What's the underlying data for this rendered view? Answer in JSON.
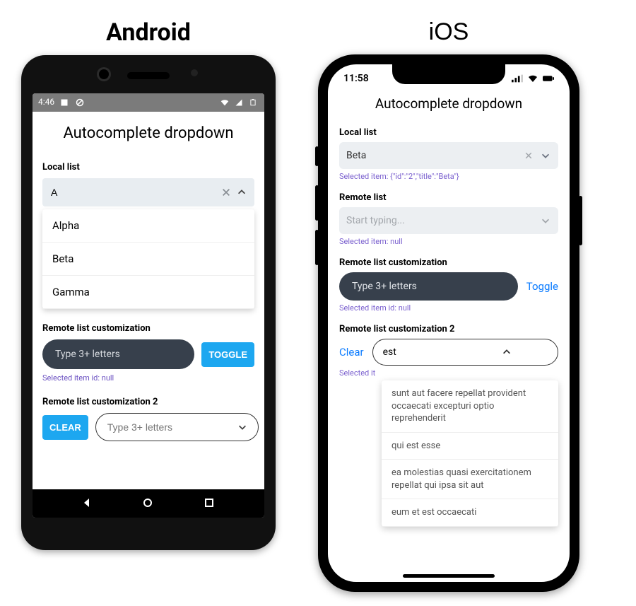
{
  "platforms": {
    "android": "Android",
    "ios": "iOS"
  },
  "android": {
    "status": {
      "time": "4:46"
    },
    "title": "Autocomplete dropdown",
    "local": {
      "heading": "Local list",
      "value": "A",
      "options": [
        "Alpha",
        "Beta",
        "Gamma"
      ]
    },
    "remote_custom": {
      "heading": "Remote list customization",
      "placeholder": "Type 3+ letters",
      "toggle": "TOGGLE",
      "hint": "Selected item id: null"
    },
    "remote_custom2": {
      "heading": "Remote list customization 2",
      "clear": "CLEAR",
      "placeholder": "Type 3+ letters"
    }
  },
  "ios": {
    "status": {
      "time": "11:58"
    },
    "title": "Autocomplete dropdown",
    "local": {
      "heading": "Local list",
      "value": "Beta",
      "hint": "Selected item: {\"id\":\"2\",\"title\":\"Beta\"}"
    },
    "remote": {
      "heading": "Remote list",
      "placeholder": "Start typing...",
      "hint": "Selected item: null"
    },
    "remote_custom": {
      "heading": "Remote list customization",
      "placeholder": "Type 3+ letters",
      "toggle": "Toggle",
      "hint": "Selected item id: null"
    },
    "remote_custom2": {
      "heading": "Remote list customization 2",
      "clear": "Clear",
      "value": "est",
      "hint_prefix": "Selected it",
      "options": [
        "sunt aut facere repellat provident occaecati excepturi optio reprehenderit",
        "qui est esse",
        "ea molestias quasi exercitationem repellat qui ipsa sit aut",
        "eum et est occaecati"
      ]
    }
  }
}
